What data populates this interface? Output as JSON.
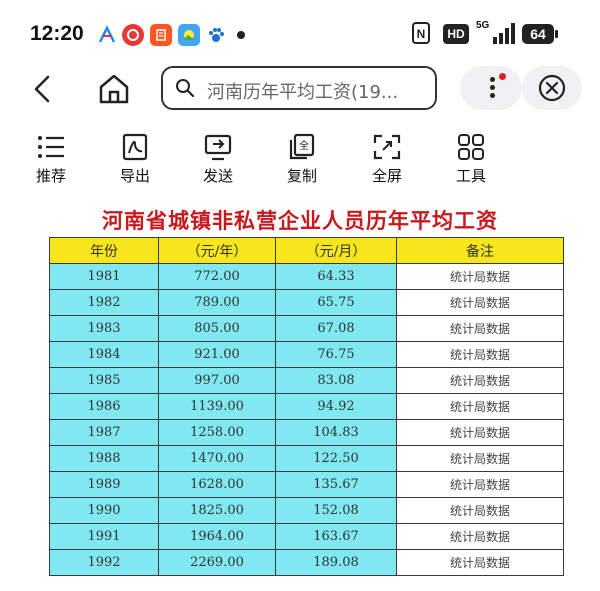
{
  "status": {
    "time": "12:20",
    "notifications": [
      {
        "icon": "antenna-app-icon",
        "color": "#1e88e5"
      },
      {
        "icon": "red-app-icon",
        "color": "#e53935"
      },
      {
        "icon": "news-app-icon",
        "color": "#ff5722"
      },
      {
        "icon": "photo-app-icon",
        "color": "#42a5f5"
      },
      {
        "icon": "paw-app-icon",
        "color": "#1976d2"
      }
    ],
    "nfc": "N",
    "hd": "HD",
    "network": "5G",
    "battery": "64"
  },
  "nav": {
    "search_text": "河南历年平均工资(19..."
  },
  "toolbar": {
    "items": [
      {
        "label": "推荐",
        "icon": "recommend-list-icon"
      },
      {
        "label": "导出",
        "icon": "export-pdf-icon"
      },
      {
        "label": "发送",
        "icon": "send-icon"
      },
      {
        "label": "复制",
        "icon": "copy-icon"
      },
      {
        "label": "全屏",
        "icon": "fullscreen-icon"
      },
      {
        "label": "工具",
        "icon": "tools-grid-icon"
      }
    ]
  },
  "document": {
    "title": "河南省城镇非私营企业人员历年平均工资",
    "headers": [
      "年份",
      "（元/年）",
      "（元/月）",
      "备注"
    ],
    "rows": [
      [
        "1981",
        "772.00",
        "64.33",
        "统计局数据"
      ],
      [
        "1982",
        "789.00",
        "65.75",
        "统计局数据"
      ],
      [
        "1983",
        "805.00",
        "67.08",
        "统计局数据"
      ],
      [
        "1984",
        "921.00",
        "76.75",
        "统计局数据"
      ],
      [
        "1985",
        "997.00",
        "83.08",
        "统计局数据"
      ],
      [
        "1986",
        "1139.00",
        "94.92",
        "统计局数据"
      ],
      [
        "1987",
        "1258.00",
        "104.83",
        "统计局数据"
      ],
      [
        "1988",
        "1470.00",
        "122.50",
        "统计局数据"
      ],
      [
        "1989",
        "1628.00",
        "135.67",
        "统计局数据"
      ],
      [
        "1990",
        "1825.00",
        "152.08",
        "统计局数据"
      ],
      [
        "1991",
        "1964.00",
        "163.67",
        "统计局数据"
      ],
      [
        "1992",
        "2269.00",
        "189.08",
        "统计局数据"
      ]
    ]
  }
}
